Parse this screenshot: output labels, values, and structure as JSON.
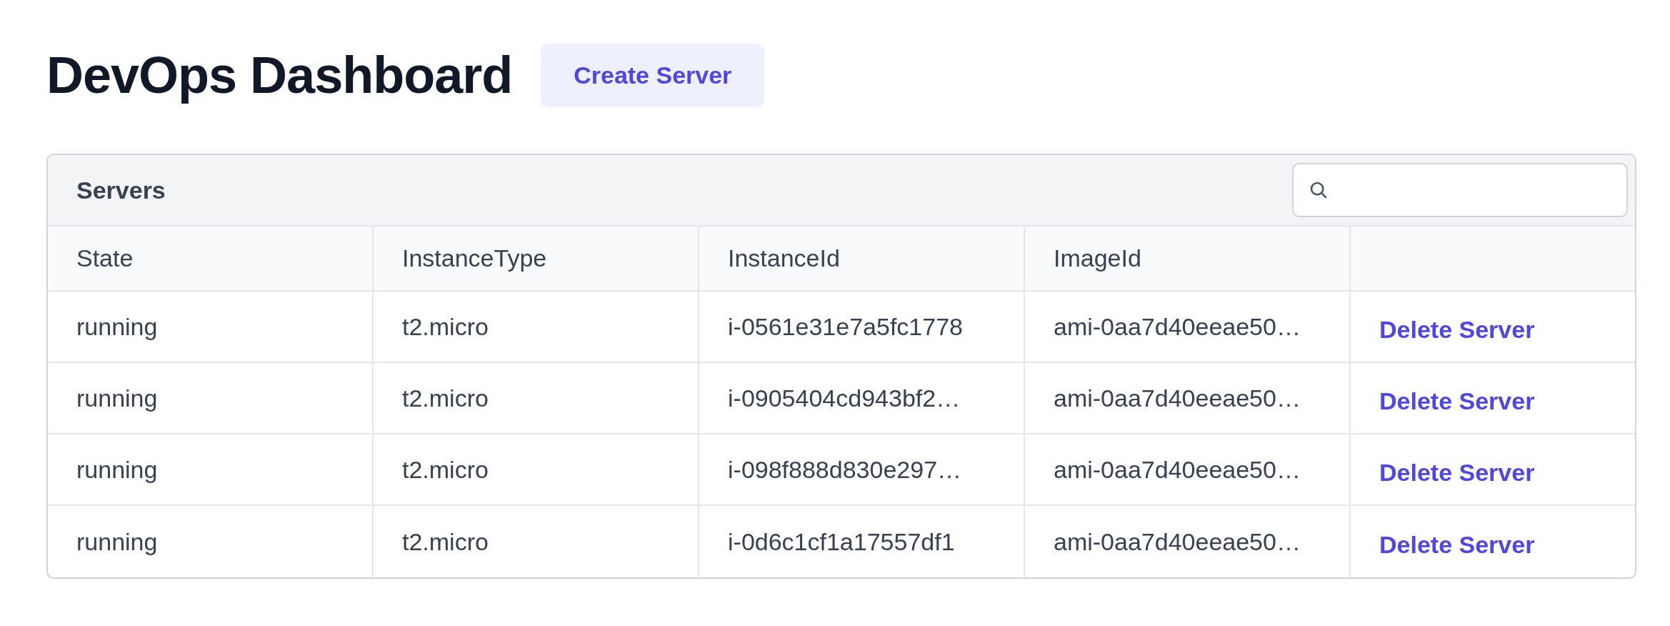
{
  "header": {
    "title": "DevOps Dashboard",
    "create_button": "Create Server"
  },
  "servers_panel": {
    "title": "Servers",
    "columns": [
      "State",
      "InstanceType",
      "InstanceId",
      "ImageId"
    ],
    "rows": [
      {
        "state": "running",
        "instance_type": "t2.micro",
        "instance_id": "i-0561e31e7a5fc1778",
        "image_id": "ami-0aa7d40eeae50…",
        "action": "Delete Server"
      },
      {
        "state": "running",
        "instance_type": "t2.micro",
        "instance_id": "i-0905404cd943bf2…",
        "image_id": "ami-0aa7d40eeae50…",
        "action": "Delete Server"
      },
      {
        "state": "running",
        "instance_type": "t2.micro",
        "instance_id": "i-098f888d830e297…",
        "image_id": "ami-0aa7d40eeae50…",
        "action": "Delete Server"
      },
      {
        "state": "running",
        "instance_type": "t2.micro",
        "instance_id": "i-0d6c1cf1a17557df1",
        "image_id": "ami-0aa7d40eeae50…",
        "action": "Delete Server"
      }
    ]
  }
}
